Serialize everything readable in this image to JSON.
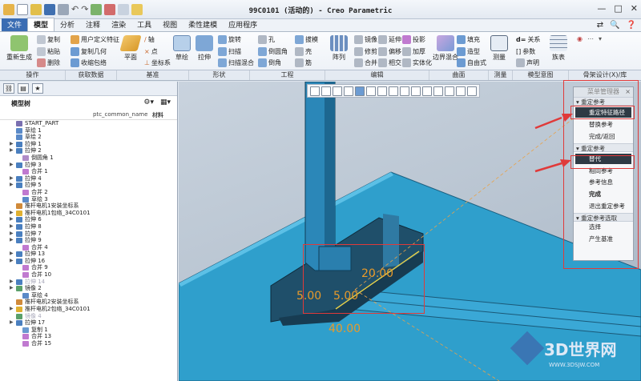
{
  "window": {
    "title": "99C0101 (活动的) - Creo Parametric",
    "minimize": "—",
    "restore": "□",
    "close": "✕"
  },
  "menu_tabs": [
    "文件",
    "模型",
    "分析",
    "注释",
    "渲染",
    "工具",
    "视图",
    "柔性建模",
    "应用程序"
  ],
  "ribbon": {
    "regenerate": "重新生成",
    "copy": "复制",
    "paste": "粘贴",
    "delete": "删除",
    "udf": "用户定义特征",
    "copy_geom": "复制几何",
    "shrinkwrap": "收缩包络",
    "plane": "平面",
    "axis": "轴",
    "point": "点",
    "csys": "坐标系",
    "sketch": "草绘",
    "extrude": "拉伸",
    "revolve": "旋转",
    "sweep": "扫描",
    "swept_blend": "扫描混合",
    "hole": "孔",
    "round": "倒圆角",
    "chamfer": "倒角",
    "draft": "拔模",
    "shell": "壳",
    "rib": "筋",
    "pattern": "阵列",
    "mirror": "镜像",
    "extend": "延伸",
    "project": "投影",
    "trim": "修剪",
    "offset": "偏移",
    "thicken": "加厚",
    "merge": "合并",
    "intersect": "相交",
    "solidify": "实体化",
    "boundary_blend": "边界混合",
    "fill": "填充",
    "style": "造型",
    "freestyle": "自由式",
    "measure": "测量",
    "relations": "关系",
    "parameters": "参数",
    "declare": "声明",
    "family_table": "族表",
    "groups": [
      "操作",
      "获取数据",
      "基准",
      "形状",
      "工程",
      "编辑",
      "曲面",
      "测量",
      "模型意图",
      "骨架设计(X)/库"
    ]
  },
  "left_panel": {
    "header": "模型树",
    "col_name": "ptc_common_name",
    "col_material": "材料",
    "items": [
      {
        "label": "START_PART",
        "color": "#7a6fb0",
        "exp": "",
        "indent": 0,
        "dim": false
      },
      {
        "label": "草绘 1",
        "color": "#5a8ac8",
        "exp": "",
        "indent": 0,
        "dim": false
      },
      {
        "label": "草绘 2",
        "color": "#5a8ac8",
        "exp": "",
        "indent": 0,
        "dim": false
      },
      {
        "label": "拉伸 1",
        "color": "#4a7fbf",
        "exp": "▶",
        "indent": 0,
        "dim": false
      },
      {
        "label": "拉伸 2",
        "color": "#4a7fbf",
        "exp": "▶",
        "indent": 0,
        "dim": false
      },
      {
        "label": "倒圆角 1",
        "color": "#b08cc8",
        "exp": "",
        "indent": 1,
        "dim": false
      },
      {
        "label": "拉伸 3",
        "color": "#4a7fbf",
        "exp": "▶",
        "indent": 0,
        "dim": false
      },
      {
        "label": "合并 1",
        "color": "#c07ad0",
        "exp": "",
        "indent": 1,
        "dim": false
      },
      {
        "label": "拉伸 4",
        "color": "#4a7fbf",
        "exp": "▶",
        "indent": 0,
        "dim": false
      },
      {
        "label": "拉伸 5",
        "color": "#4a7fbf",
        "exp": "▶",
        "indent": 0,
        "dim": false
      },
      {
        "label": "合并 2",
        "color": "#c07ad0",
        "exp": "",
        "indent": 1,
        "dim": false
      },
      {
        "label": "草绘 3",
        "color": "#5a8ac8",
        "exp": "",
        "indent": 1,
        "dim": false
      },
      {
        "label": "推杆电机1安装坐标系",
        "color": "#d08a3a",
        "exp": "",
        "indent": 0,
        "dim": false
      },
      {
        "label": "推杆电机1包络_34C0101",
        "color": "#e0b030",
        "exp": "▶",
        "indent": 0,
        "dim": false
      },
      {
        "label": "拉伸 6",
        "color": "#4a7fbf",
        "exp": "▶",
        "indent": 0,
        "dim": false
      },
      {
        "label": "拉伸 8",
        "color": "#4a7fbf",
        "exp": "▶",
        "indent": 0,
        "dim": false
      },
      {
        "label": "拉伸 7",
        "color": "#4a7fbf",
        "exp": "▶",
        "indent": 0,
        "dim": false
      },
      {
        "label": "拉伸 9",
        "color": "#4a7fbf",
        "exp": "▶",
        "indent": 0,
        "dim": false
      },
      {
        "label": "合并 4",
        "color": "#c07ad0",
        "exp": "",
        "indent": 1,
        "dim": false
      },
      {
        "label": "拉伸 13",
        "color": "#4a7fbf",
        "exp": "▶",
        "indent": 0,
        "dim": false
      },
      {
        "label": "拉伸 16",
        "color": "#4a7fbf",
        "exp": "▶",
        "indent": 0,
        "dim": false
      },
      {
        "label": "合并 9",
        "color": "#c07ad0",
        "exp": "",
        "indent": 1,
        "dim": false
      },
      {
        "label": "合并 10",
        "color": "#c07ad0",
        "exp": "",
        "indent": 1,
        "dim": false
      },
      {
        "label": "拉伸 14",
        "color": "#4a7fbf",
        "exp": "▶",
        "indent": 0,
        "dim": true
      },
      {
        "label": "镜像 2",
        "color": "#5aa06a",
        "exp": "▶",
        "indent": 0,
        "dim": false
      },
      {
        "label": "草绘 4",
        "color": "#5a8ac8",
        "exp": "",
        "indent": 1,
        "dim": false
      },
      {
        "label": "推杆电机2安装坐标系",
        "color": "#d08a3a",
        "exp": "",
        "indent": 0,
        "dim": false
      },
      {
        "label": "推杆电机2包络_34C0101",
        "color": "#e0b030",
        "exp": "▶",
        "indent": 0,
        "dim": false
      },
      {
        "label": "镜像 4",
        "color": "#5aa06a",
        "exp": "",
        "indent": 0,
        "dim": true
      },
      {
        "label": "拉伸 17",
        "color": "#4a7fbf",
        "exp": "▶",
        "indent": 0,
        "dim": false
      },
      {
        "label": "复制 1",
        "color": "#6a9ad0",
        "exp": "",
        "indent": 1,
        "dim": false
      },
      {
        "label": "合并 13",
        "color": "#c07ad0",
        "exp": "",
        "indent": 1,
        "dim": false
      },
      {
        "label": "合并 15",
        "color": "#c07ad0",
        "exp": "",
        "indent": 1,
        "dim": false
      }
    ]
  },
  "viewport": {
    "dims": [
      "5.00",
      "5.00",
      "20.00",
      "40.00"
    ],
    "watermark": "3D世界网",
    "watermark_url": "WWW.3DSJW.COM"
  },
  "menu_manager": {
    "title": "菜单管理器",
    "close": "×",
    "sec1": "重定参考",
    "items1": [
      "重定特征路径",
      "替换参考",
      "完成/返回"
    ],
    "sec2": "重定参考",
    "items2": [
      "替代",
      "相同参考",
      "参考信息",
      "完成",
      "退出重定参考"
    ],
    "sec3": "重定参考选取",
    "items3": [
      "选择",
      "产生基准"
    ]
  }
}
